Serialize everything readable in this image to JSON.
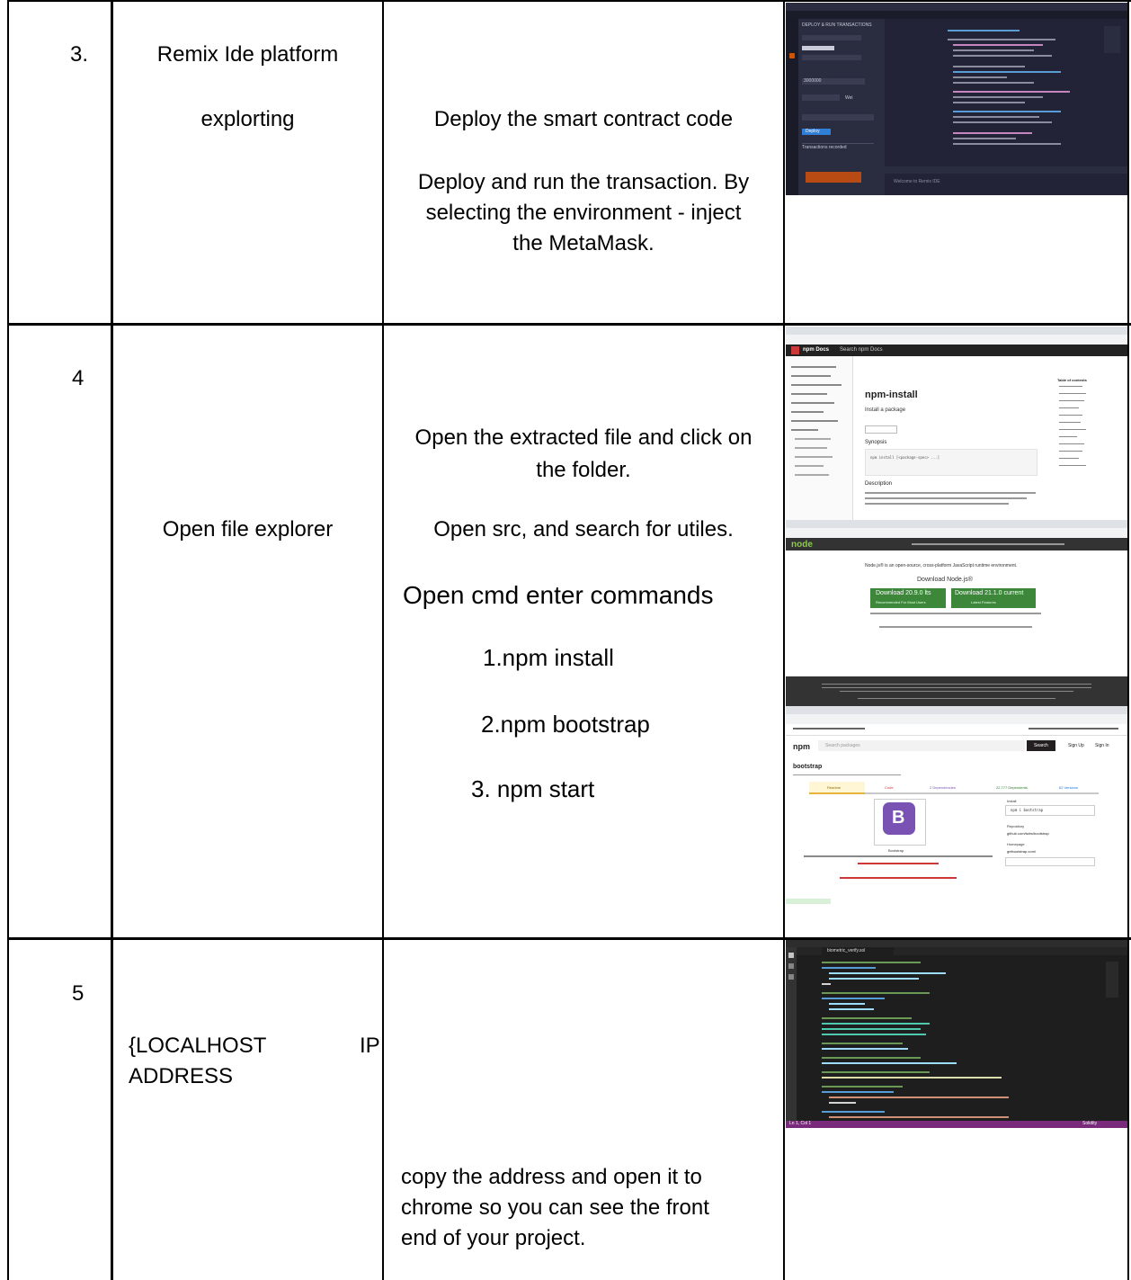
{
  "rows": [
    {
      "number": "3.",
      "title_line1": "Remix Ide platform",
      "title_line2": "explorting",
      "desc_line1": "Deploy the smart contract code",
      "desc_line2": "Deploy and run the transaction. By",
      "desc_line3": "selecting the environment - inject",
      "desc_line4": "the MetaMask.",
      "screenshot": {
        "panel_title": "DEPLOY & RUN TRANSACTIONS",
        "value_field": "3000000",
        "unit": "Wei",
        "deploy_label": "Deploy",
        "transactions_label": "Transactions recorded",
        "code_hint": "Welcome to Remix IDE"
      }
    },
    {
      "number": "4",
      "title": "Open file explorer",
      "desc_line1": "Open the extracted file and click on",
      "desc_line2": "the folder.",
      "desc_line3": "Open src, and search for utiles.",
      "desc_line4": "Open cmd enter commands",
      "cmd1": "1.npm install",
      "cmd2": "2.npm bootstrap",
      "cmd3": "3. npm start",
      "screenshot_npm_docs": {
        "brand": "npm Docs",
        "search": "Search npm Docs",
        "heading": "npm-install",
        "subheading": "Install a package",
        "section1": "Synopsis",
        "section2": "Description",
        "toc_title": "Table of contents",
        "command": "npm install [<package-spec> ...]"
      },
      "screenshot_node": {
        "logo": "node",
        "tagline": "Node.js® is an open-source, cross-platform JavaScript runtime environment.",
        "download_title": "Download Node.js®",
        "lts_button": "Download 20.9.0 lts",
        "lts_sub": "Recommended For Most Users",
        "current_button": "Download 21.1.0 current",
        "current_sub": "Latest Features"
      },
      "screenshot_bootstrap": {
        "brand": "npm",
        "search": "Search packages",
        "search_button": "Search",
        "signup": "Sign Up",
        "signin": "Sign In",
        "package": "bootstrap",
        "logo_letter": "B",
        "logo_caption": "Bootstrap",
        "install_label": "Install",
        "install_cmd": "npm i bootstrap",
        "repo_label": "Repository",
        "repo": "github.com/twbs/bootstrap",
        "home_label": "Homepage",
        "home": "getbootstrap.com/",
        "tabs": [
          "Readme",
          "Code",
          "2 Dependencies",
          "22,777 Dependents",
          "62 Versions"
        ]
      }
    },
    {
      "number": "5",
      "title_part1": "{LOCALHOST",
      "title_part2": "IP",
      "title_line2": "ADDRESS",
      "desc_line1": "copy the address and open it to",
      "desc_line2": "chrome so you can see the front",
      "desc_line3": "end of your project.",
      "screenshot": {
        "file_tab": "biometric_verify.sol",
        "status_left": "Ln 1, Col 1",
        "status_right": "Solidity"
      }
    }
  ],
  "colors": {
    "border": "#000000",
    "remix_bg": "#222336",
    "remix_accent": "#d35400",
    "node_green": "#3c873a",
    "npm_red": "#cb3837",
    "bootstrap_purple": "#7952b3",
    "vscode_bg": "#1e1e1e"
  }
}
